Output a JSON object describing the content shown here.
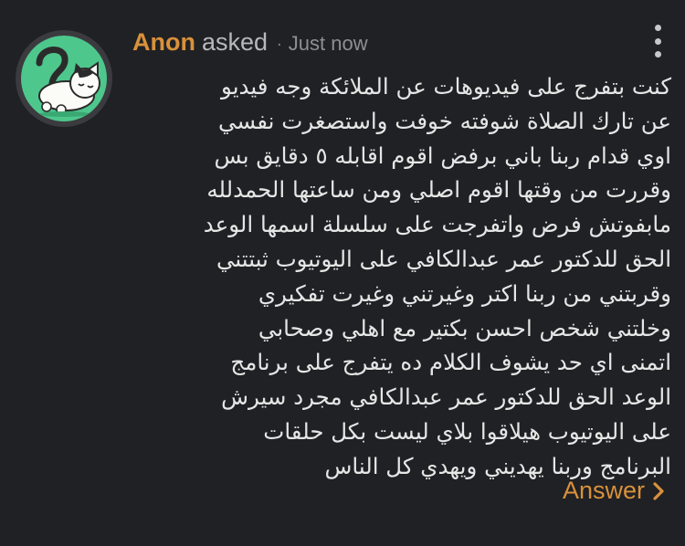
{
  "post": {
    "author": "Anon",
    "verb": "asked",
    "separator": "·",
    "timestamp": "Just now",
    "question_lines": [
      "كنت بتفرج على فيديوهات عن الملائكة وجه فيديو",
      "عن تارك الصلاة شوفته خوفت واستصغرت نفسي",
      "اوي قدام ربنا باني برفض اقوم اقابله ٥ دقايق بس",
      "وقررت من وقتها اقوم اصلي ومن ساعتها الحمدلله",
      "مابفوتش فرض واتفرجت على سلسلة اسمها الوعد",
      "الحق للدكتور عمر عبدالكافي على اليوتيوب ثبتتني",
      "وقربتني من ربنا اكتر وغيرتني وغيرت تفكيري",
      "وخلتني شخص احسن بكتير مع اهلي وصحابي",
      "اتمنى اي حد يشوف الكلام ده يتفرج على برنامج",
      "الوعد الحق للدكتور عمر عبدالكافي مجرد سيرش",
      "على اليوتيوب هيلاقوا بلاي ليست بكل حلقات",
      "البرنامج وربنا يهديني ويهدي كل الناس"
    ],
    "answer_label": "Answer"
  },
  "icons": {
    "avatar": "cartoon-cat-question-mark-avatar",
    "menu": "more-vertical-icon",
    "answer_chevron": "chevron-right-icon"
  },
  "colors": {
    "background": "#202124",
    "accent": "#d9913b",
    "avatar_bg": "#4ec78d",
    "text": "#e6e6e6",
    "muted": "#8e8e93"
  }
}
